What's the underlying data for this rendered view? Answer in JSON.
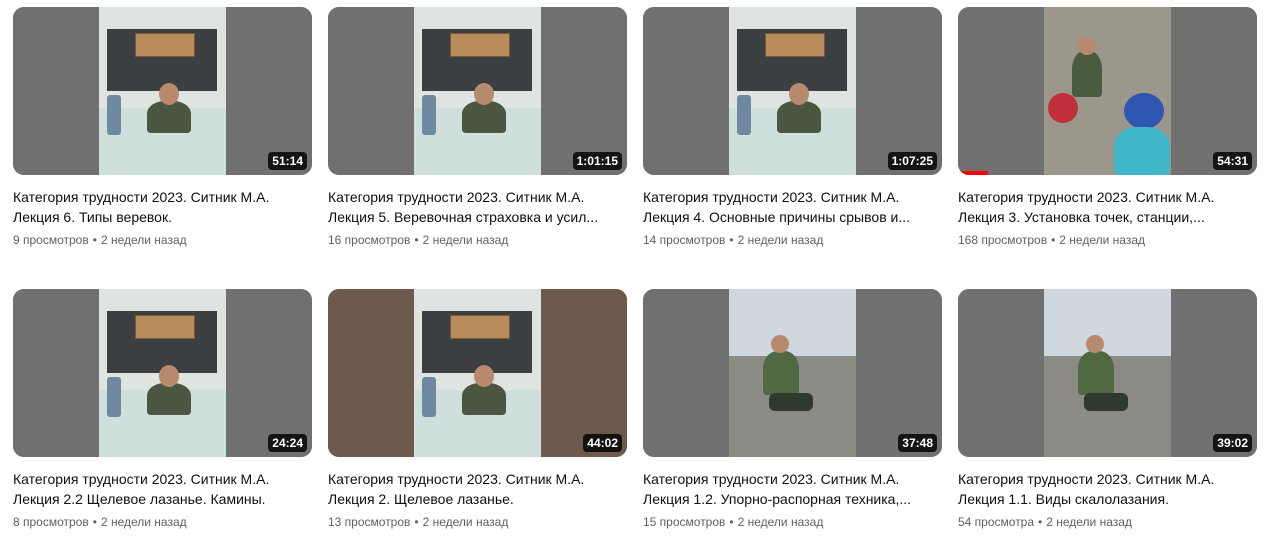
{
  "videos": [
    {
      "title_line1": "Категория трудности 2023. Ситник М.А.",
      "title_line2": "Лекция 6. Типы веревок.",
      "views": "9 просмотров",
      "age": "2 недели назад",
      "duration": "51:14",
      "scene": "classroom"
    },
    {
      "title_line1": "Категория трудности 2023. Ситник М.А.",
      "title_line2": "Лекция 5. Веревочная страховка и усил...",
      "views": "16 просмотров",
      "age": "2 недели назад",
      "duration": "1:01:15",
      "scene": "classroom"
    },
    {
      "title_line1": "Категория трудности 2023. Ситник М.А.",
      "title_line2": "Лекция 4. Основные причины срывов и...",
      "views": "14 просмотров",
      "age": "2 недели назад",
      "duration": "1:07:25",
      "scene": "classroom"
    },
    {
      "title_line1": "Категория трудности 2023. Ситник М.А.",
      "title_line2": "Лекция 3. Установка точек, станции,...",
      "views": "168 просмотров",
      "age": "2 недели назад",
      "duration": "54:31",
      "scene": "climbing",
      "watched_fraction": 0.1
    },
    {
      "title_line1": "Категория трудности 2023. Ситник М.А.",
      "title_line2": "Лекция 2.2 Щелевое лазанье. Камины.",
      "views": "8 просмотров",
      "age": "2 недели назад",
      "duration": "24:24",
      "scene": "classroom"
    },
    {
      "title_line1": "Категория трудности 2023. Ситник М.А.",
      "title_line2": "Лекция 2. Щелевое лазанье.",
      "views": "13 просмотров",
      "age": "2 недели назад",
      "duration": "44:02",
      "scene": "classroom"
    },
    {
      "title_line1": "Категория трудности 2023. Ситник М.А.",
      "title_line2": "Лекция 1.2. Упорно-распорная техника,...",
      "views": "15 просмотров",
      "age": "2 недели назад",
      "duration": "37:48",
      "scene": "outdoor"
    },
    {
      "title_line1": "Категория трудности 2023. Ситник М.А.",
      "title_line2": "Лекция 1.1. Виды скалолазания.",
      "views": "54 просмотра",
      "age": "2 недели назад",
      "duration": "39:02",
      "scene": "outdoor"
    }
  ],
  "meta_separator": "•",
  "colors": {
    "duration_bg": "#000000",
    "progress": "#ff0000",
    "meta_text": "#606060",
    "title_text": "#0f0f0f"
  }
}
